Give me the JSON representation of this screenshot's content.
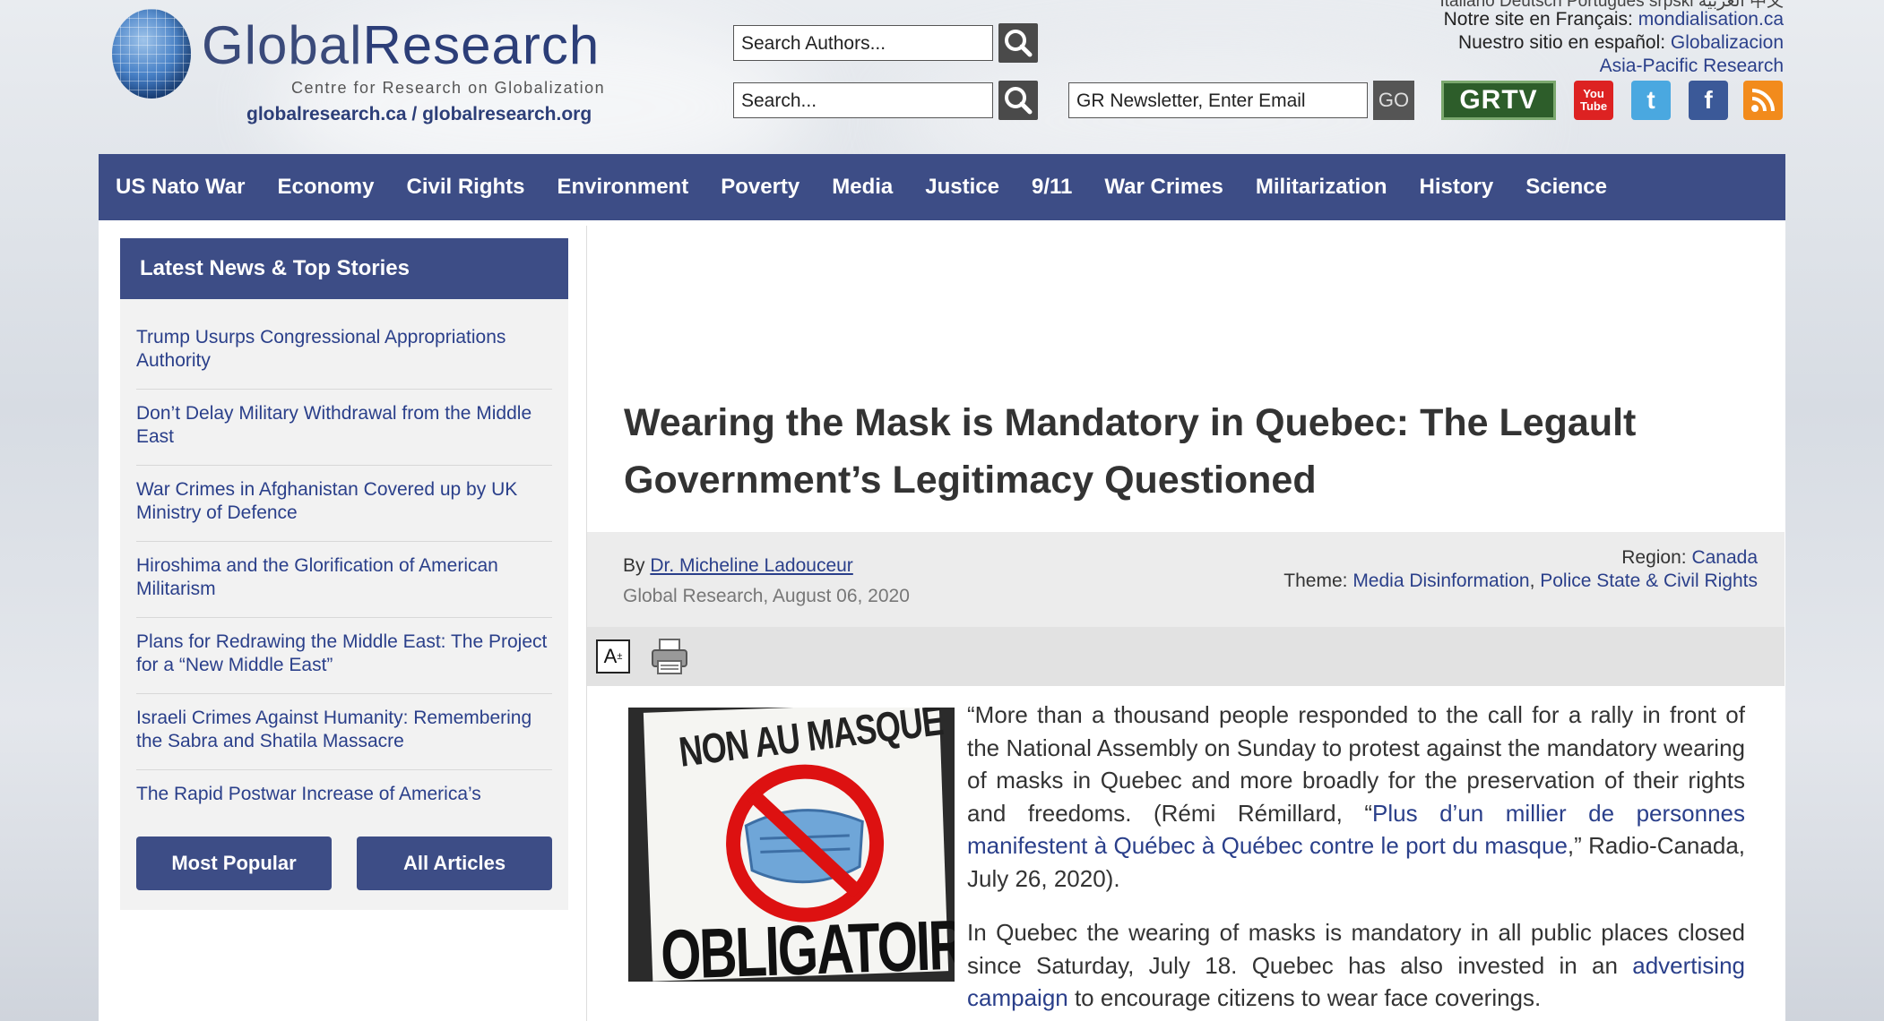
{
  "logo": {
    "title_part1": "Global",
    "title_part2": "Research",
    "subtitle": "Centre for Research on Globalization",
    "urls": "globalresearch.ca / globalresearch.org"
  },
  "search": {
    "authors_placeholder": "Search Authors...",
    "site_placeholder": "Search...",
    "newsletter_placeholder": "GR Newsletter, Enter Email",
    "go_label": "GO"
  },
  "languages": {
    "top_partial": "Italiano  Deutsch  Português  srpski  العربية  中文",
    "french_label": "Notre site en Français: ",
    "french_link": "mondialisation.ca",
    "spanish_label": "Nuestro sitio en español: ",
    "spanish_link": "Globalizacion",
    "asia_link": "Asia-Pacific Research"
  },
  "social": {
    "grtv": "GRTV",
    "youtube": "You Tube",
    "twitter": "t",
    "facebook": "f",
    "rss": "rss"
  },
  "nav": [
    "US Nato War",
    "Economy",
    "Civil Rights",
    "Environment",
    "Poverty",
    "Media",
    "Justice",
    "9/11",
    "War Crimes",
    "Militarization",
    "History",
    "Science"
  ],
  "sidebar": {
    "heading": "Latest News & Top Stories",
    "items": [
      "Trump Usurps Congressional Appropriations Authority",
      "Don’t Delay Military Withdrawal from the Middle East",
      "War Crimes in Afghanistan Covered up by UK Ministry of Defence",
      "Hiroshima and the Glorification of American Militarism",
      "Plans for Redrawing the Middle East: The Project for a “New Middle East”",
      "Israeli Crimes Against Humanity: Remembering the Sabra and Shatila Massacre",
      "The Rapid Postwar Increase of America’s"
    ],
    "most_popular": "Most Popular",
    "all_articles": "All Articles"
  },
  "article": {
    "title": "Wearing the Mask is Mandatory in Quebec: The Legault Government’s Legitimacy Questioned",
    "by_label": "By ",
    "author": "Dr. Micheline Ladouceur",
    "date": "Global Research, August 06, 2020",
    "region_label": "Region: ",
    "region": "Canada",
    "theme_label": "Theme: ",
    "theme1": "Media Disinformation",
    "theme_sep": ", ",
    "theme2": "Police State & Civil Rights",
    "font_tool": "A",
    "image_text_top": "NON AU MASQUE",
    "image_text_bottom": "OBLIGATOIRE",
    "p1_a": "“More than a thousand people responded to the call for a rally in front of the National Assembly on Sunday to protest against the mandatory wearing of masks in Quebec and more broadly for the preservation of their rights and freedoms. (Rémi Rémillard, “",
    "p1_link": "Plus d’un millier de personnes manifestent à Québec à Québec contre le port du masque",
    "p1_b": ",” Radio-Canada, July 26, 2020).",
    "p2_a": "In Quebec the wearing of masks is mandatory in all public places closed since Saturday, July 18. Quebec has also invested in an ",
    "p2_link": "advertising campaign",
    "p2_b": " to encourage citizens to wear face coverings."
  },
  "colors": {
    "nav": "#3d4d86",
    "link": "#2a3f8a"
  }
}
